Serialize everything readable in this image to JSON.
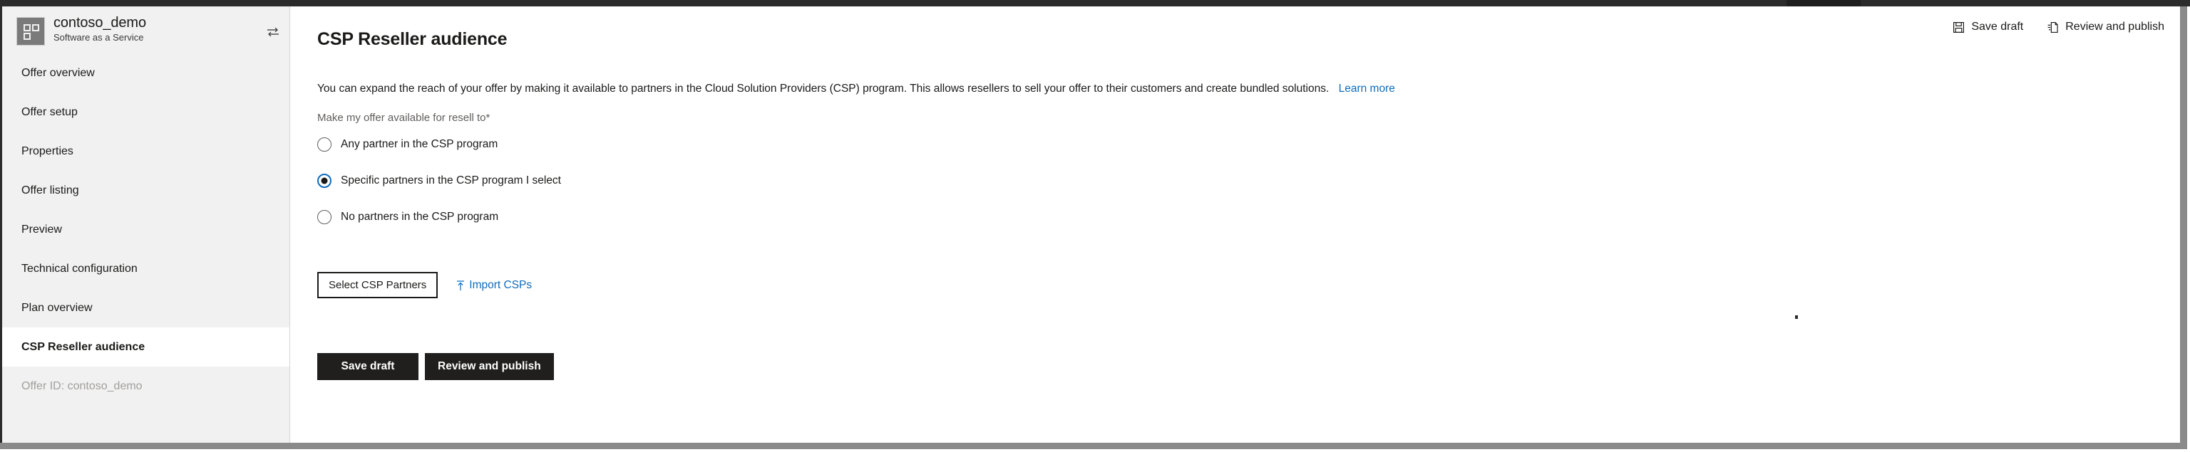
{
  "colors": {
    "accent_link": "#0f6cbd",
    "primary_button_bg": "#201f1e",
    "sidebar_bg": "#f1f1f1",
    "topbar_bg": "#2b2b2b",
    "selected_nav_bg": "#ffffff"
  },
  "sidebar": {
    "offer": {
      "icon": "app-tile-icon",
      "title": "contoso_demo",
      "subtitle": "Software as a Service",
      "swap_icon": "swap-offers-icon"
    },
    "items": [
      {
        "label": "Offer overview",
        "selected": false
      },
      {
        "label": "Offer setup",
        "selected": false
      },
      {
        "label": "Properties",
        "selected": false
      },
      {
        "label": "Offer listing",
        "selected": false
      },
      {
        "label": "Preview",
        "selected": false
      },
      {
        "label": "Technical configuration",
        "selected": false
      },
      {
        "label": "Plan overview",
        "selected": false
      },
      {
        "label": "CSP Reseller audience",
        "selected": true
      }
    ],
    "offer_id_label": "Offer ID: contoso_demo"
  },
  "header": {
    "title": "CSP Reseller audience",
    "actions": [
      {
        "label": "Save draft",
        "icon": "save-icon"
      },
      {
        "label": "Review and publish",
        "icon": "publish-document-icon"
      }
    ]
  },
  "main": {
    "description": "You can expand the reach of your offer by making it available to partners in the Cloud Solution Providers (CSP) program. This allows resellers to sell your offer to their customers and create bundled solutions.",
    "learn_more_label": "Learn more",
    "field_label": "Make my offer available for resell to*",
    "radio_options": [
      {
        "label": "Any partner in the CSP program",
        "checked": false
      },
      {
        "label": "Specific partners in the CSP program I select",
        "checked": true
      },
      {
        "label": "No partners in the CSP program",
        "checked": false
      }
    ],
    "select_partners_label": "Select CSP Partners",
    "import_csps_label": "Import CSPs",
    "import_icon": "upload-icon",
    "footer_buttons": [
      {
        "label": "Save draft"
      },
      {
        "label": "Review and publish"
      }
    ]
  }
}
